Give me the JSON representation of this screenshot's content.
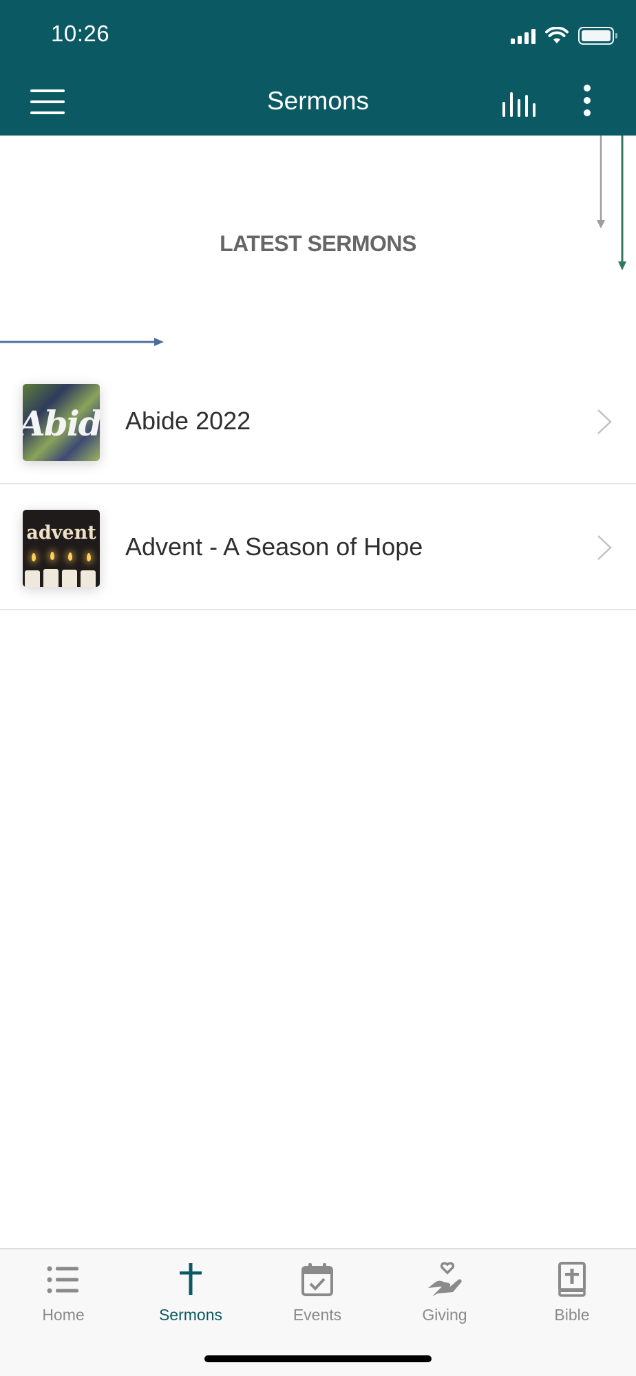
{
  "status_bar": {
    "time": "10:26"
  },
  "header": {
    "title": "Sermons",
    "bg_color": "#0b5963"
  },
  "section": {
    "title": "LATEST SERMONS"
  },
  "sermons": [
    {
      "title": "Abide 2022",
      "thumb_text": "Abide"
    },
    {
      "title": "Advent - A Season of Hope",
      "thumb_text": "advent"
    }
  ],
  "tabs": [
    {
      "label": "Home",
      "icon": "list-icon"
    },
    {
      "label": "Sermons",
      "icon": "cross-icon",
      "active": true
    },
    {
      "label": "Events",
      "icon": "calendar-check-icon"
    },
    {
      "label": "Giving",
      "icon": "giving-hand-icon"
    },
    {
      "label": "Bible",
      "icon": "bible-icon"
    }
  ],
  "colors": {
    "accent": "#0b5963",
    "tab_inactive": "#8a8a8a"
  }
}
